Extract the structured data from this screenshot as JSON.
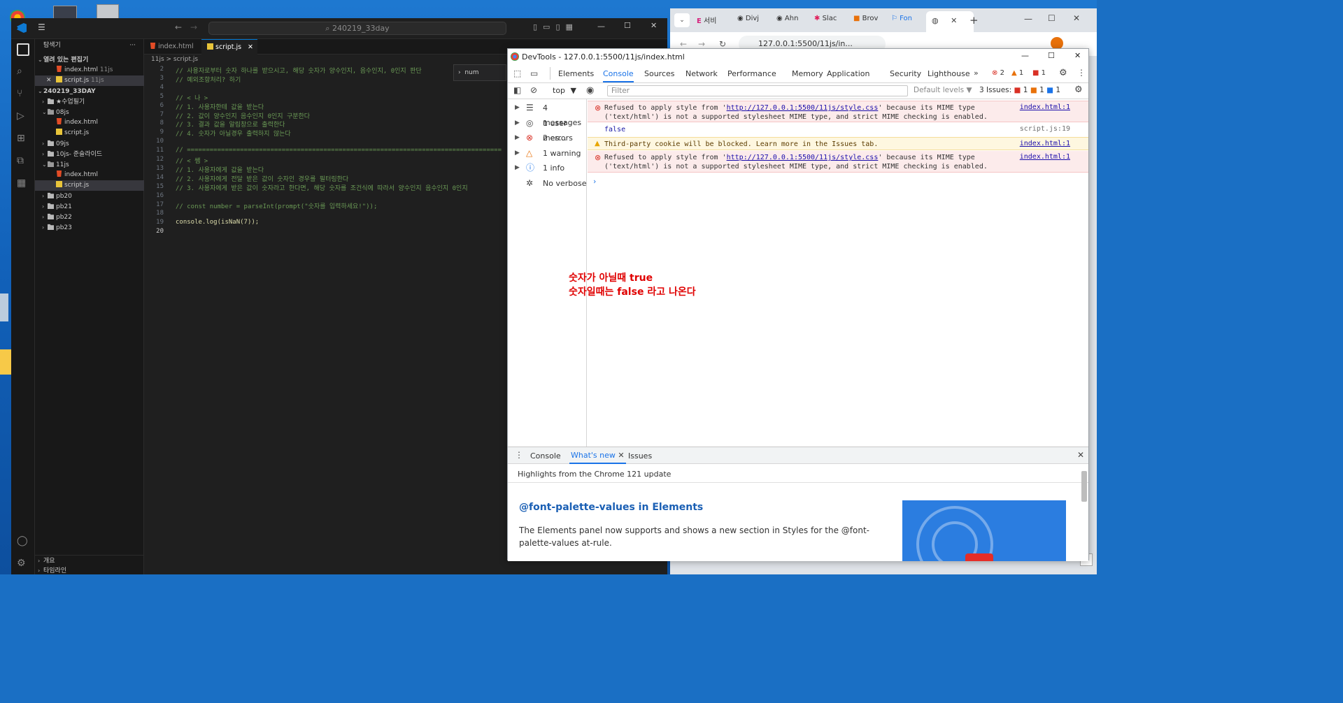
{
  "vscode": {
    "search_text": "240219_33day",
    "explorer_title": "탐색기",
    "open_editors": "열려 있는 편집기",
    "open_files": [
      {
        "name": "index.html",
        "dir": "11js"
      },
      {
        "name": "script.js",
        "dir": "11js"
      }
    ],
    "workspace": "240219_33DAY",
    "tree": [
      {
        "label": "★수업필기",
        "type": "dir"
      },
      {
        "label": "08js",
        "type": "dir-open"
      },
      {
        "label": "index.html",
        "type": "html"
      },
      {
        "label": "script.js",
        "type": "js"
      },
      {
        "label": "09js",
        "type": "dir"
      },
      {
        "label": "10js- 준슬라이드",
        "type": "dir"
      },
      {
        "label": "11js",
        "type": "dir-open"
      },
      {
        "label": "index.html",
        "type": "html"
      },
      {
        "label": "script.js",
        "type": "js"
      },
      {
        "label": "pb20",
        "type": "dir"
      },
      {
        "label": "pb21",
        "type": "dir"
      },
      {
        "label": "pb22",
        "type": "dir"
      },
      {
        "label": "pb23",
        "type": "dir"
      }
    ],
    "outline": "개요",
    "timeline": "타임라인",
    "tabs": [
      {
        "label": "index.html"
      },
      {
        "label": "script.js"
      }
    ],
    "breadcrumb": "11js  >  script.js",
    "peek_label": "num",
    "code_lines": [
      {
        "n": "2",
        "text": "// 사용자로부터 숫자 하나를 받으시고, 해당 숫자가 양수인지, 음수인지, 0인지 판단"
      },
      {
        "n": "3",
        "text": "// 예외조항처리? 하기"
      },
      {
        "n": "4",
        "text": ""
      },
      {
        "n": "5",
        "text": "// < 나 >"
      },
      {
        "n": "6",
        "text": "// 1. 사용자한테 값을 받는다"
      },
      {
        "n": "7",
        "text": "// 2. 값이 양수인지 음수인지 0인지 구분한다"
      },
      {
        "n": "8",
        "text": "// 3. 결과 값을 알림창으로 출력한다"
      },
      {
        "n": "9",
        "text": "// 4. 숫자가 아닐경우 출력하지 않는다"
      },
      {
        "n": "10",
        "text": ""
      },
      {
        "n": "11",
        "text": "// ==================================================================================="
      },
      {
        "n": "12",
        "text": "// < 쌤 >"
      },
      {
        "n": "13",
        "text": "// 1. 사용자에게 값을 받는다"
      },
      {
        "n": "14",
        "text": "// 2. 사용자에게 전달 받은 값이 숫자인 경우를 필터링한다"
      },
      {
        "n": "15",
        "text": "// 3. 사용자에게 받은 값이 숫자라고 한다면, 해당 숫자를 조건식에 따라서 양수인지 음수인지 0인지"
      },
      {
        "n": "16",
        "text": ""
      },
      {
        "n": "17",
        "text": "// const number = parseInt(prompt(\"숫자를 입력하세요!\"));"
      },
      {
        "n": "18",
        "text": ""
      },
      {
        "n": "19",
        "text": "console.log(isNaN(7));"
      },
      {
        "n": "20",
        "text": ""
      }
    ]
  },
  "chrome": {
    "tabs": [
      "서비",
      "Divj",
      "Ahn",
      "Slac",
      "Brov",
      "Fon"
    ],
    "address": "127.0.0.1:5500/11js/in..."
  },
  "devtools": {
    "title": "DevTools - 127.0.0.1:5500/11js/index.html",
    "tabs": [
      "Elements",
      "Console",
      "Sources",
      "Network",
      "Performance",
      "Memory",
      "Application",
      "Security",
      "Lighthouse"
    ],
    "active_tab": "Console",
    "badges": {
      "errors": "2",
      "warnings": "1",
      "issues": "1"
    },
    "context": "top",
    "filter_placeholder": "Filter",
    "levels": "Default levels",
    "issues_label": "3 Issues:",
    "issue_counts": [
      "1",
      "1",
      "1"
    ],
    "sidebar": [
      {
        "label": "4 messages",
        "icon": "list-icon"
      },
      {
        "label": "1 user mes...",
        "icon": "user-icon"
      },
      {
        "label": "2 errors",
        "icon": "error-icon"
      },
      {
        "label": "1 warning",
        "icon": "warning-icon"
      },
      {
        "label": "1 info",
        "icon": "info-icon"
      },
      {
        "label": "No verbose",
        "icon": "bug-icon"
      }
    ],
    "messages": {
      "err1_pre": "Refused to apply style from '",
      "err1_url": "http://127.0.0.1:5500/11js/style.css",
      "err1_post": "' because its MIME type ('text/html') is not a supported stylesheet MIME type, and strict MIME checking is enabled.",
      "err1_src": "index.html:1",
      "log": "false",
      "log_src": "script.js:19",
      "warn": "Third-party cookie will be blocked. Learn more in the Issues tab.",
      "warn_src": "index.html:1",
      "err2_pre": "Refused to apply style from '",
      "err2_url": "http://127.0.0.1:5500/11js/style.css",
      "err2_post": "' because its MIME type ('text/html') is not a supported stylesheet MIME type, and strict MIME checking is enabled.",
      "err2_src": "index.html:1"
    },
    "annotation_line1": "숫자가 아닐때 true",
    "annotation_line2": "숫자일때는 false 라고 나온다",
    "drawer_tabs": [
      "Console",
      "What's new",
      "Issues"
    ],
    "drawer_active": "What's new",
    "drawer_highlights": "Highlights from the Chrome 121 update",
    "drawer_heading": "@font-palette-values in Elements",
    "drawer_body": "The Elements panel now supports and shows a new section in Styles for the @font-palette-values at-rule."
  },
  "colors": {
    "accent": "#1a73e8",
    "error": "#d93025",
    "annotation": "#e00000",
    "vscode_bg": "#1e1e1e"
  }
}
